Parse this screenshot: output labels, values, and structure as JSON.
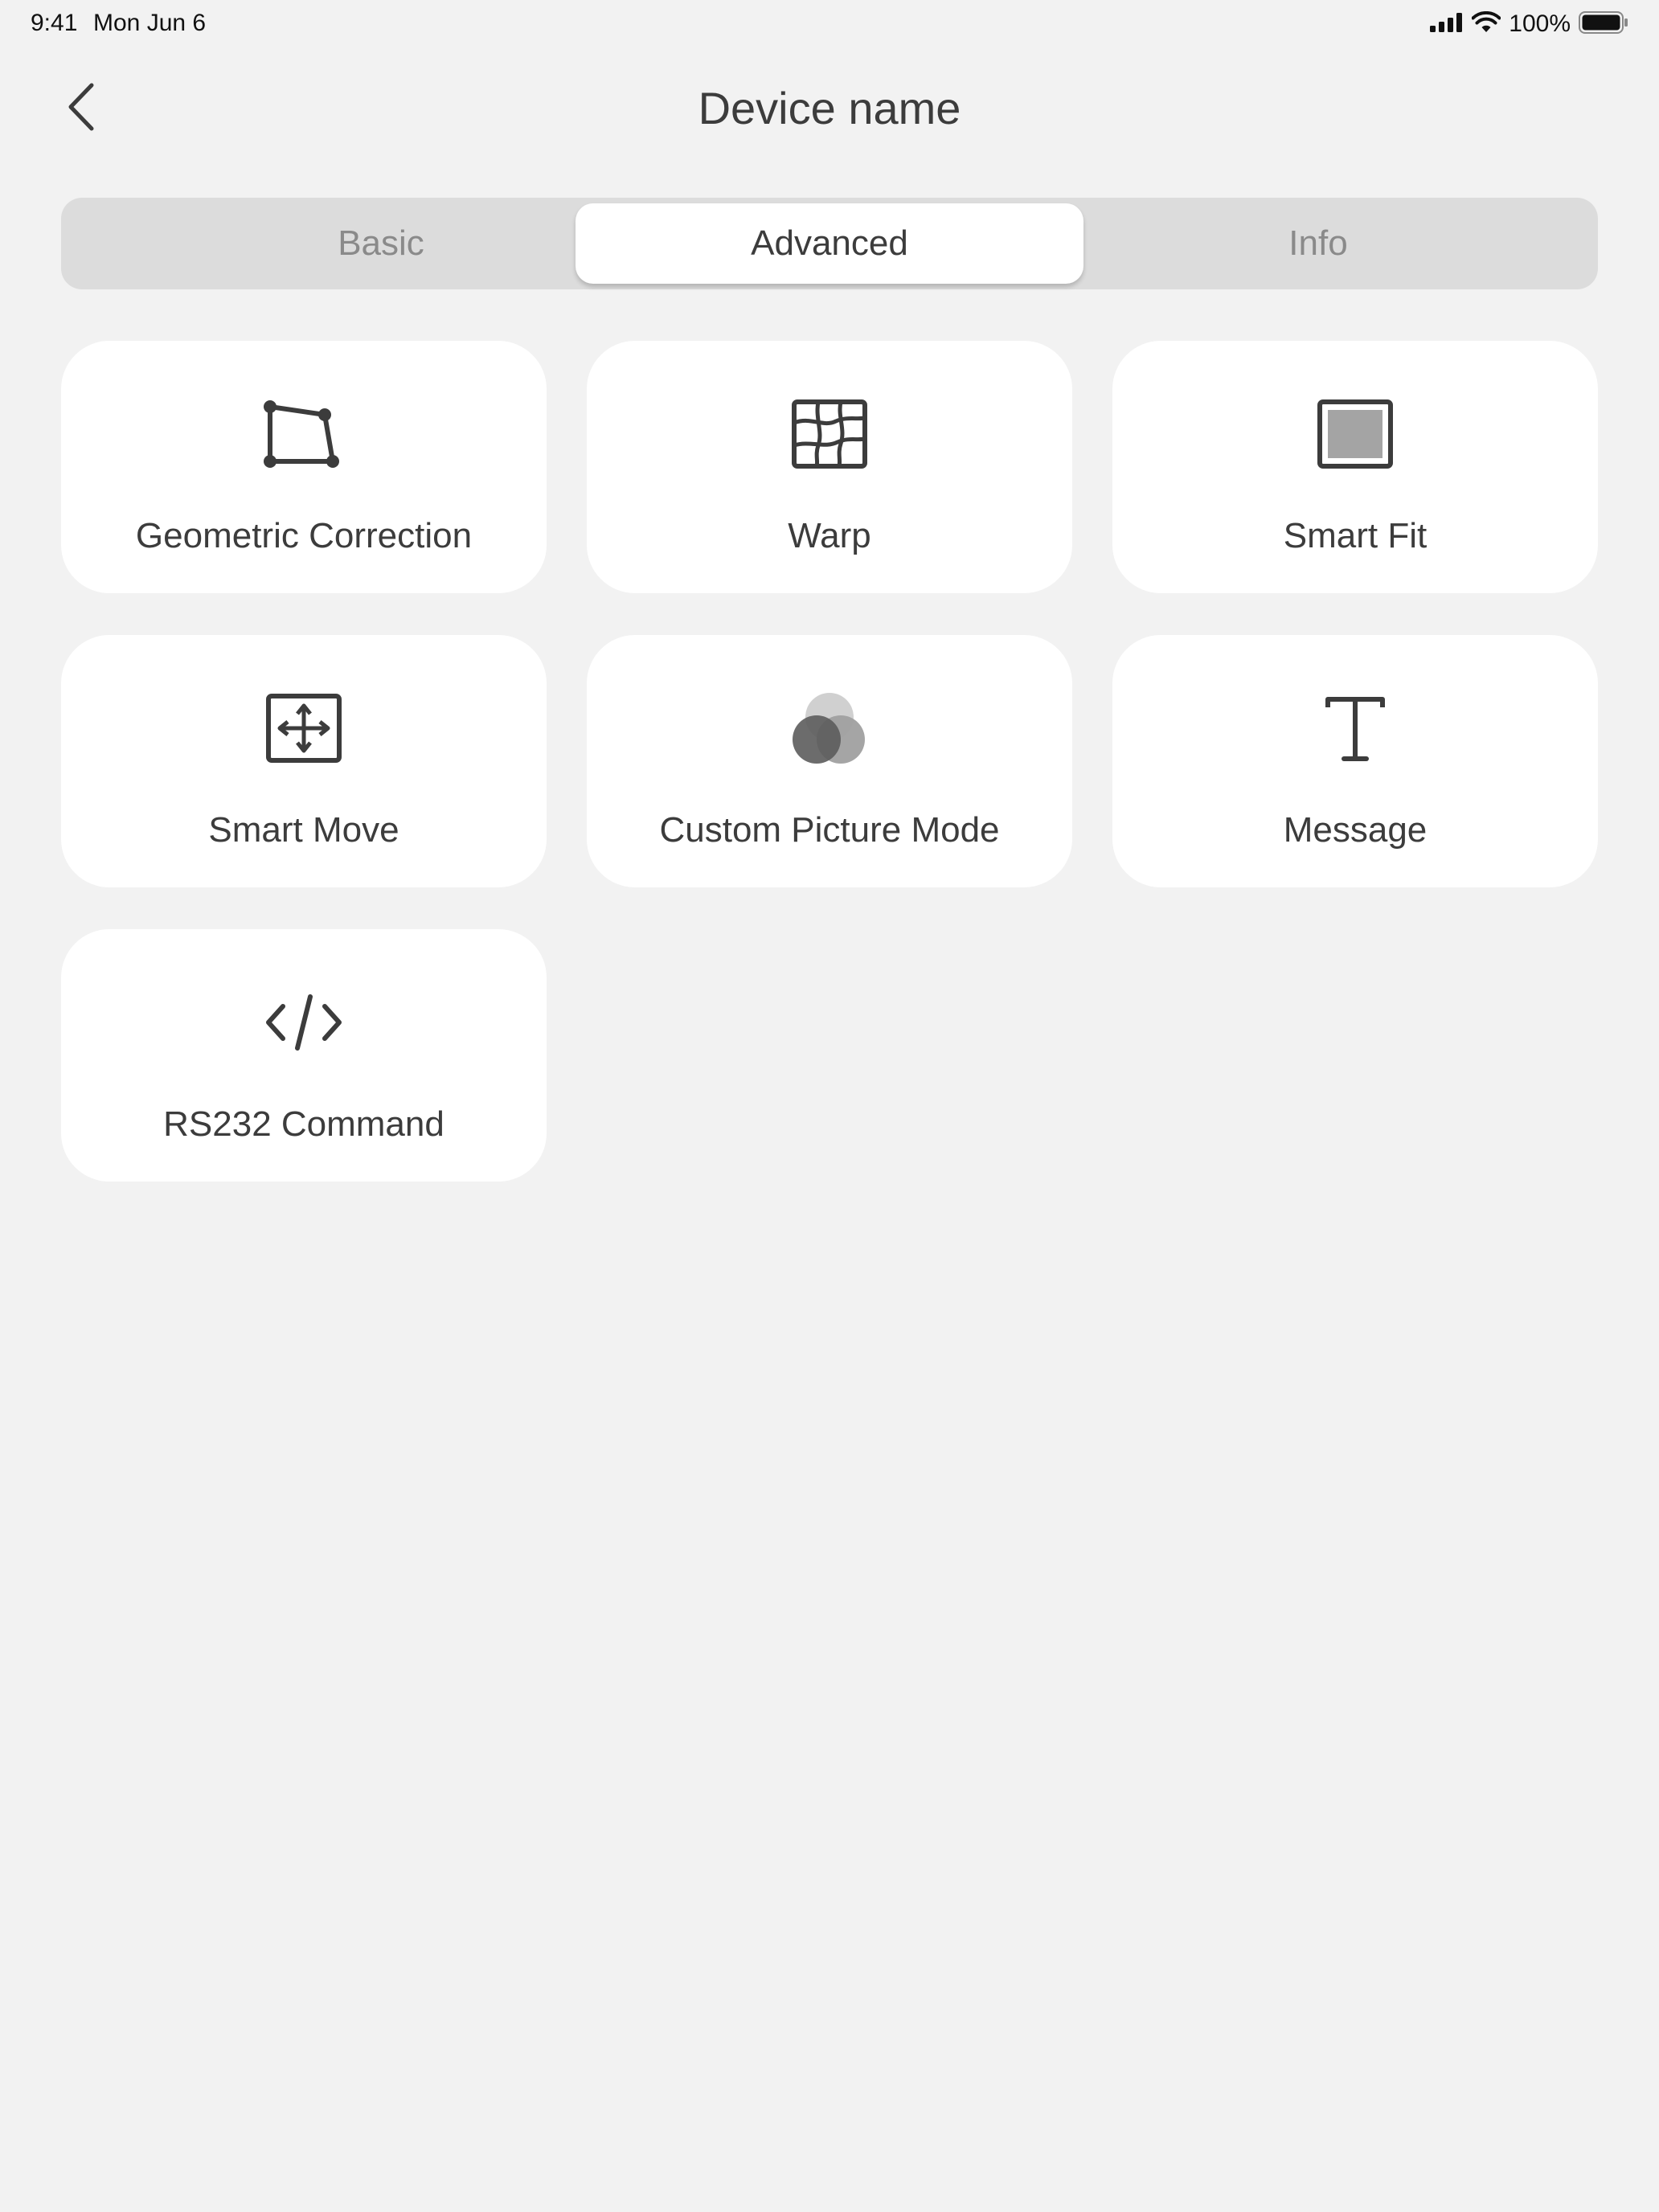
{
  "status_bar": {
    "time": "9:41",
    "date": "Mon Jun 6",
    "battery": "100%"
  },
  "nav": {
    "title": "Device name",
    "back_icon": "chevron-left-icon"
  },
  "tabs": {
    "items": [
      {
        "label": "Basic",
        "selected": false
      },
      {
        "label": "Advanced",
        "selected": true
      },
      {
        "label": "Info",
        "selected": false
      }
    ]
  },
  "tiles": [
    {
      "label": "Geometric Correction",
      "icon": "geometric-correction-icon"
    },
    {
      "label": "Warp",
      "icon": "warp-grid-icon"
    },
    {
      "label": "Smart Fit",
      "icon": "smart-fit-icon"
    },
    {
      "label": "Smart Move",
      "icon": "move-arrows-icon"
    },
    {
      "label": "Custom Picture Mode",
      "icon": "color-circles-icon"
    },
    {
      "label": "Message",
      "icon": "text-t-icon"
    },
    {
      "label": "RS232 Command",
      "icon": "code-brackets-icon"
    }
  ],
  "colors": {
    "background": "#f2f2f2",
    "card": "#ffffff",
    "segment_track": "#dcdcdc",
    "text": "#3c3c3c",
    "muted_text": "#8a8a8a"
  }
}
